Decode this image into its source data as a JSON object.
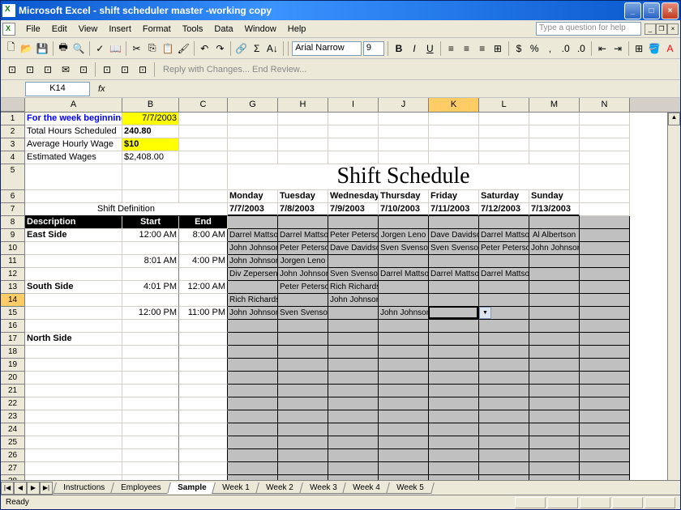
{
  "title": "Microsoft Excel - shift scheduler master -working copy",
  "menu": {
    "file": "File",
    "edit": "Edit",
    "view": "View",
    "insert": "Insert",
    "format": "Format",
    "tools": "Tools",
    "data": "Data",
    "window": "Window",
    "help": "Help"
  },
  "help_placeholder": "Type a question for help",
  "font": {
    "name": "Arial Narrow",
    "size": "9"
  },
  "reply_text": "Reply with Changes...  End Review...",
  "namebox": "K14",
  "colwidths": {
    "A": 120,
    "B": 70,
    "C": 60,
    "G": 62,
    "H": 62,
    "I": 62,
    "J": 62,
    "K": 62,
    "L": 62,
    "M": 62,
    "N": 62
  },
  "cols": [
    "A",
    "B",
    "C",
    "G",
    "H",
    "I",
    "J",
    "K",
    "L",
    "M",
    "N"
  ],
  "row_labels": [
    "1",
    "2",
    "3",
    "4",
    "5",
    "6",
    "7",
    "8",
    "9",
    "10",
    "11",
    "12",
    "13",
    "14",
    "15",
    "16",
    "17",
    "18",
    "19",
    "20",
    "21",
    "22",
    "23",
    "24",
    "25",
    "26",
    "27",
    "28"
  ],
  "summary": {
    "week_label": "For the week beginning:",
    "week_date": "7/7/2003",
    "hours_label": "Total Hours Scheduled",
    "hours_value": "240.80",
    "wage_label": "Average Hourly Wage",
    "wage_value": "$10",
    "est_label": "Estimated Wages",
    "est_value": "$2,408.00"
  },
  "schedule": {
    "title": "Shift Schedule",
    "shift_def": "Shift Definition",
    "desc": "Description",
    "start": "Start",
    "end": "End",
    "days": [
      "Monday",
      "Tuesday",
      "Wednesday",
      "Thursday",
      "Friday",
      "Saturday",
      "Sunday"
    ],
    "dates": [
      "7/7/2003",
      "7/8/2003",
      "7/9/2003",
      "7/10/2003",
      "7/11/2003",
      "7/12/2003",
      "7/13/2003"
    ],
    "rows": [
      {
        "desc": "East Side",
        "start": "12:00 AM",
        "end": "8:00 AM",
        "d": [
          "Darrel Mattson",
          "Darrel Mattson",
          "Peter Peterson",
          "Jorgen Leno",
          "Dave Davidson",
          "Darrel Mattson",
          "Al Albertson"
        ]
      },
      {
        "desc": "",
        "start": "",
        "end": "",
        "d": [
          "John Johnson",
          "Peter Peterson",
          "Dave Davidson",
          "Sven Svenson",
          "Sven Svenson",
          "Peter Peterson",
          "John Johnson"
        ]
      },
      {
        "desc": "",
        "start": "8:01 AM",
        "end": "4:00 PM",
        "d": [
          "John Johnson",
          "Jorgen Leno",
          "",
          "",
          "",
          "",
          ""
        ]
      },
      {
        "desc": "",
        "start": "",
        "end": "",
        "d": [
          "Div Zepersen",
          "John Johnson",
          "Sven Svenson",
          "Darrel Mattson",
          "Darrel Mattson",
          "Darrel Mattson",
          ""
        ]
      },
      {
        "desc": "South Side",
        "start": "4:01 PM",
        "end": "12:00 AM",
        "d": [
          "",
          "Peter Peterson",
          "Rich Richardson",
          "",
          "",
          "",
          ""
        ]
      },
      {
        "desc": "",
        "start": "",
        "end": "",
        "d": [
          "Rich Richardson",
          "",
          "John Johnson",
          "",
          "",
          "",
          ""
        ]
      },
      {
        "desc": "",
        "start": "12:00 PM",
        "end": "11:00 PM",
        "d": [
          "John Johnson",
          "Sven Svenson",
          "",
          "John Johnson",
          "",
          "",
          ""
        ]
      },
      {
        "desc": "",
        "start": "",
        "end": "",
        "d": [
          "",
          "",
          "",
          "",
          "",
          "",
          ""
        ]
      },
      {
        "desc": "North Side",
        "start": "",
        "end": "",
        "d": [
          "",
          "",
          "",
          "",
          "",
          "",
          ""
        ]
      },
      {
        "desc": "",
        "start": "",
        "end": "",
        "d": [
          "",
          "",
          "",
          "",
          "",
          "",
          ""
        ]
      },
      {
        "desc": "",
        "start": "",
        "end": "",
        "d": [
          "",
          "",
          "",
          "",
          "",
          "",
          ""
        ]
      },
      {
        "desc": "",
        "start": "",
        "end": "",
        "d": [
          "",
          "",
          "",
          "",
          "",
          "",
          ""
        ]
      },
      {
        "desc": "",
        "start": "",
        "end": "",
        "d": [
          "",
          "",
          "",
          "",
          "",
          "",
          ""
        ]
      },
      {
        "desc": "",
        "start": "",
        "end": "",
        "d": [
          "",
          "",
          "",
          "",
          "",
          "",
          ""
        ]
      },
      {
        "desc": "",
        "start": "",
        "end": "",
        "d": [
          "",
          "",
          "",
          "",
          "",
          "",
          ""
        ]
      },
      {
        "desc": "",
        "start": "",
        "end": "",
        "d": [
          "",
          "",
          "",
          "",
          "",
          "",
          ""
        ]
      },
      {
        "desc": "",
        "start": "",
        "end": "",
        "d": [
          "",
          "",
          "",
          "",
          "",
          "",
          ""
        ]
      },
      {
        "desc": "",
        "start": "",
        "end": "",
        "d": [
          "",
          "",
          "",
          "",
          "",
          "",
          ""
        ]
      },
      {
        "desc": "",
        "start": "",
        "end": "",
        "d": [
          "",
          "",
          "",
          "",
          "",
          "",
          ""
        ]
      },
      {
        "desc": "",
        "start": "",
        "end": "",
        "d": [
          "",
          "",
          "",
          "",
          "",
          "",
          ""
        ]
      }
    ]
  },
  "tabs": [
    "Instructions",
    "Employees",
    "Sample",
    "Week 1",
    "Week 2",
    "Week 3",
    "Week 4",
    "Week 5"
  ],
  "active_tab": 2,
  "status": "Ready"
}
